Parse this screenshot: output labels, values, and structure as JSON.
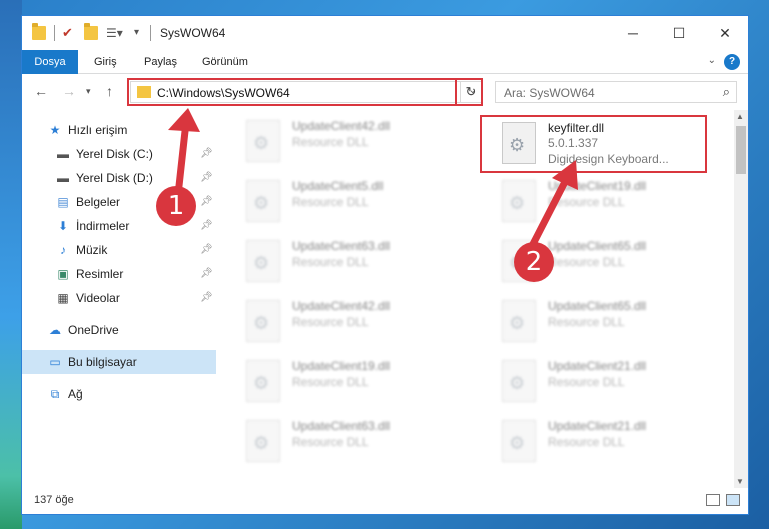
{
  "window": {
    "title": "SysWOW64",
    "minimize": "─",
    "maximize": "☐",
    "close": "✕"
  },
  "ribbon": {
    "tabs": [
      "Dosya",
      "Giriş",
      "Paylaş",
      "Görünüm"
    ],
    "help": "?"
  },
  "address": {
    "path": "C:\\Windows\\SysWOW64",
    "search_placeholder": "Ara: SysWOW64"
  },
  "sidebar": {
    "items": [
      {
        "label": "Hızlı erişim",
        "icon": "star-icon"
      },
      {
        "label": "Yerel Disk (C:)",
        "icon": "drive-icon"
      },
      {
        "label": "Yerel Disk (D:)",
        "icon": "drive-icon"
      },
      {
        "label": "Belgeler",
        "icon": "documents-icon"
      },
      {
        "label": "İndirmeler",
        "icon": "download-icon"
      },
      {
        "label": "Müzik",
        "icon": "music-icon"
      },
      {
        "label": "Resimler",
        "icon": "pictures-icon"
      },
      {
        "label": "Videolar",
        "icon": "video-icon"
      },
      {
        "label": "OneDrive",
        "icon": "cloud-icon"
      },
      {
        "label": "Bu bilgisayar",
        "icon": "computer-icon"
      },
      {
        "label": "Ağ",
        "icon": "network-icon"
      }
    ]
  },
  "files": {
    "highlighted": {
      "name": "keyfilter.dll",
      "version": "5.0.1.337",
      "description": "Digidesign Keyboard..."
    },
    "left_column": [
      {
        "name": "UpdateClient42.dll",
        "sub": "Resource DLL"
      },
      {
        "name": "UpdateClient5.dll",
        "sub": "Resource DLL"
      },
      {
        "name": "UpdateClient63.dll",
        "sub": "Resource DLL"
      },
      {
        "name": "UpdateClient42.dll",
        "sub": "Resource DLL"
      },
      {
        "name": "UpdateClient19.dll",
        "sub": "Resource DLL"
      },
      {
        "name": "UpdateClient63.dll",
        "sub": "Resource DLL"
      }
    ],
    "right_column": [
      {
        "name": "UpdateClient19.dll",
        "sub": "Resource DLL"
      },
      {
        "name": "UpdateClient65.dll",
        "sub": "Resource DLL"
      },
      {
        "name": "UpdateClient65.dll",
        "sub": "Resource DLL"
      },
      {
        "name": "UpdateClient21.dll",
        "sub": "Resource DLL"
      },
      {
        "name": "UpdateClient21.dll",
        "sub": "Resource DLL"
      }
    ]
  },
  "status": {
    "count": "137 öğe"
  },
  "annotations": {
    "marker1": "1",
    "marker2": "2",
    "color": "#d9363e"
  }
}
